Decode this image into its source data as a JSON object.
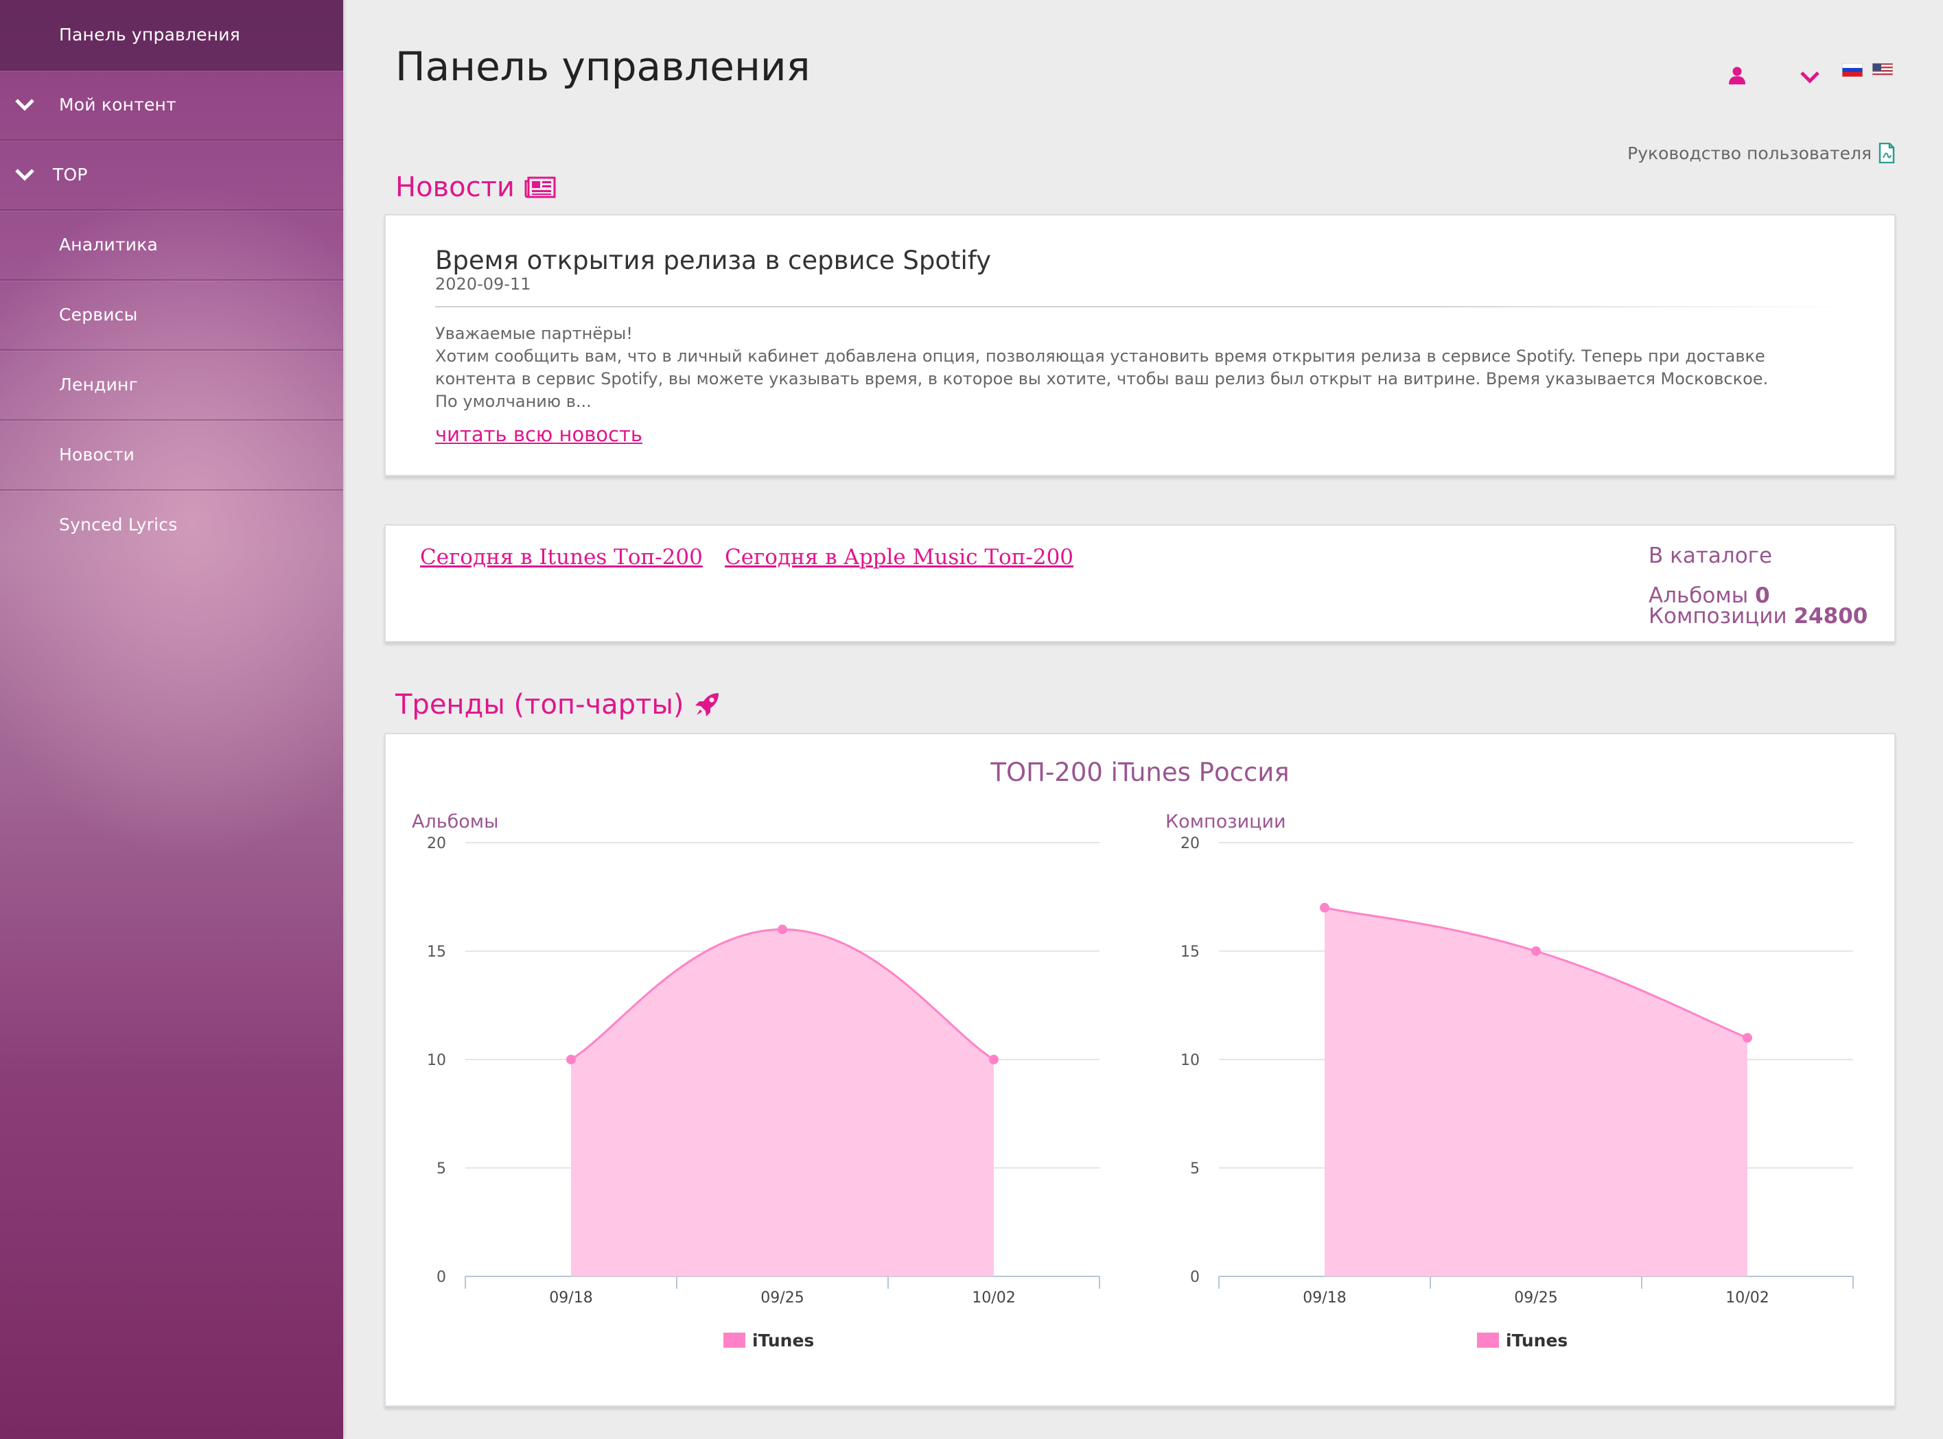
{
  "sidebar": {
    "items": [
      {
        "label": "Панель управления",
        "active": true,
        "chevron": false
      },
      {
        "label": "Мой контент",
        "active": false,
        "chevron": true
      },
      {
        "label": "TOP",
        "active": false,
        "chevron": true
      },
      {
        "label": "Аналитика",
        "active": false,
        "chevron": false
      },
      {
        "label": "Сервисы",
        "active": false,
        "chevron": false
      },
      {
        "label": "Лендинг",
        "active": false,
        "chevron": false
      },
      {
        "label": "Новости",
        "active": false,
        "chevron": false
      },
      {
        "label": "Synced Lyrics",
        "active": false,
        "chevron": false
      }
    ]
  },
  "header": {
    "title": "Панель управления",
    "user_icon": "user-icon",
    "dropdown_icon": "chevron-down-icon",
    "languages": [
      "ru-flag-icon",
      "us-flag-icon"
    ],
    "user_guide": "Руководство пользователя",
    "user_guide_icon": "pdf-icon"
  },
  "news": {
    "section_title": "Новости",
    "section_icon": "newspaper-icon",
    "item": {
      "title": "Время открытия релиза в сервисе Spotify",
      "date": "2020-09-11",
      "body": [
        "Уважаемые партнёры!",
        "Хотим сообщить вам, что в личный кабинет добавлена опция, позволяющая установить время открытия релиза в сервисе Spotify. Теперь при доставке контента в сервис Spotify, вы можете указывать время, в которое вы хотите, чтобы ваш релиз был открыт на витрине. Время указывается Московское.",
        "По умолчанию в..."
      ],
      "read_more": "читать всю новость"
    }
  },
  "catalog": {
    "link_itunes": "Сегодня в Itunes Топ-200",
    "link_apple_music": "Сегодня в Apple Music Топ-200",
    "heading": "В каталоге",
    "albums_label": "Альбомы",
    "albums_value": "0",
    "tracks_label": "Композиции",
    "tracks_value": "24800"
  },
  "trends": {
    "section_title": "Тренды (топ-чарты)",
    "section_icon": "rocket-icon",
    "chart_title": "ТОП-200 iTunes Россия"
  },
  "colors": {
    "accent": "#e0168c",
    "muted_purple": "#9a5590",
    "area_fill": "#ffc6e6",
    "area_line": "#ff82c8"
  },
  "chart_data": [
    {
      "type": "area",
      "title": "",
      "ylabel": "Альбомы",
      "x": [
        "09/18",
        "09/25",
        "10/02"
      ],
      "series": [
        {
          "name": "iTunes",
          "values": [
            10,
            16,
            10
          ]
        }
      ],
      "ylim": [
        0,
        20
      ],
      "yticks": [
        0,
        5,
        10,
        15,
        20
      ],
      "grid": true,
      "legend": "bottom-center"
    },
    {
      "type": "area",
      "title": "",
      "ylabel": "Композиции",
      "x": [
        "09/18",
        "09/25",
        "10/02"
      ],
      "series": [
        {
          "name": "iTunes",
          "values": [
            17,
            15,
            11
          ]
        }
      ],
      "ylim": [
        0,
        20
      ],
      "yticks": [
        0,
        5,
        10,
        15,
        20
      ],
      "grid": true,
      "legend": "bottom-center"
    }
  ]
}
